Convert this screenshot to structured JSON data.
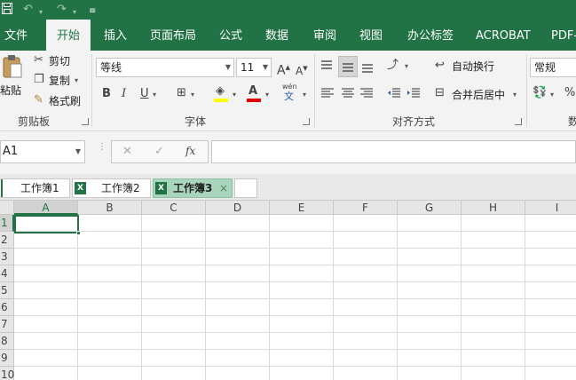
{
  "titlebar": {
    "save_icon": "save-icon",
    "undo_icon": "undo-icon",
    "redo_icon": "redo-icon",
    "customize_icon": "customize-qat-icon"
  },
  "ribbon_tabs": [
    {
      "label": "文件",
      "active": false
    },
    {
      "label": "开始",
      "active": true
    },
    {
      "label": "插入",
      "active": false
    },
    {
      "label": "页面布局",
      "active": false
    },
    {
      "label": "公式",
      "active": false
    },
    {
      "label": "数据",
      "active": false
    },
    {
      "label": "审阅",
      "active": false
    },
    {
      "label": "视图",
      "active": false
    },
    {
      "label": "办公标签",
      "active": false
    },
    {
      "label": "ACROBAT",
      "active": false
    },
    {
      "label": "PDF-",
      "active": false
    }
  ],
  "clipboard": {
    "paste_label": "粘贴",
    "cut_label": "剪切",
    "copy_label": "复制",
    "format_painter_label": "格式刷",
    "group_label": "剪贴板"
  },
  "font": {
    "font_name": "等线",
    "font_size": "11",
    "bold": "B",
    "italic": "I",
    "underline": "U",
    "phonetic_top": "wén",
    "phonetic_bottom": "文",
    "group_label": "字体"
  },
  "alignment": {
    "wrap_text_label": "自动换行",
    "merge_center_label": "合并后居中",
    "group_label": "对齐方式"
  },
  "number": {
    "format_value": "常规",
    "percent": "%",
    "group_label": "数"
  },
  "formula_bar": {
    "name_box": "A1",
    "fx_label": "fx",
    "cancel_glyph": "✕",
    "enter_glyph": "✓",
    "formula_value": ""
  },
  "workbook_tabs": [
    {
      "label": "工作簿1",
      "active": false
    },
    {
      "label": "工作簿2",
      "active": false
    },
    {
      "label": "工作簿3",
      "active": true
    }
  ],
  "workbook_close_glyph": "×",
  "grid": {
    "columns": [
      "A",
      "B",
      "C",
      "D",
      "E",
      "F",
      "G",
      "H",
      "I"
    ],
    "rows": [
      "1",
      "2",
      "3",
      "4",
      "5",
      "6",
      "7",
      "8",
      "9",
      "10"
    ],
    "selected_cell": "A1"
  },
  "colors": {
    "brand_green": "#217346",
    "ribbon_bg": "#f3f3f3",
    "active_tab_bg": "#a9d5bc"
  }
}
